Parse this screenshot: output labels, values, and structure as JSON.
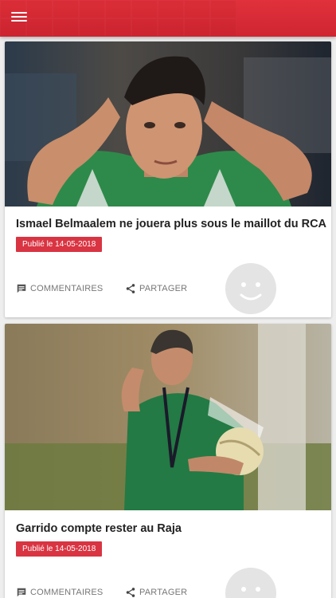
{
  "appbar": {
    "menu_icon": "hamburger-menu-icon",
    "color": "#d92e39"
  },
  "articles": [
    {
      "title": "Ismael Belmaalem ne jouera plus sous le maillot du RCA",
      "date_label": "Publié le 14-05-2018",
      "comments_label": "COMMENTAIRES",
      "share_label": "PARTAGER",
      "image_icon": "player-photo",
      "avatar_icon": "smiley-face-icon"
    },
    {
      "title": "Garrido compte rester au Raja",
      "date_label": "Publié le 14-05-2018",
      "comments_label": "COMMENTAIRES",
      "share_label": "PARTAGER",
      "image_icon": "coach-photo",
      "avatar_icon": "smiley-face-icon"
    }
  ],
  "colors": {
    "badge": "#d93442",
    "action_text": "#777777",
    "avatar": "#e4e4e4"
  }
}
